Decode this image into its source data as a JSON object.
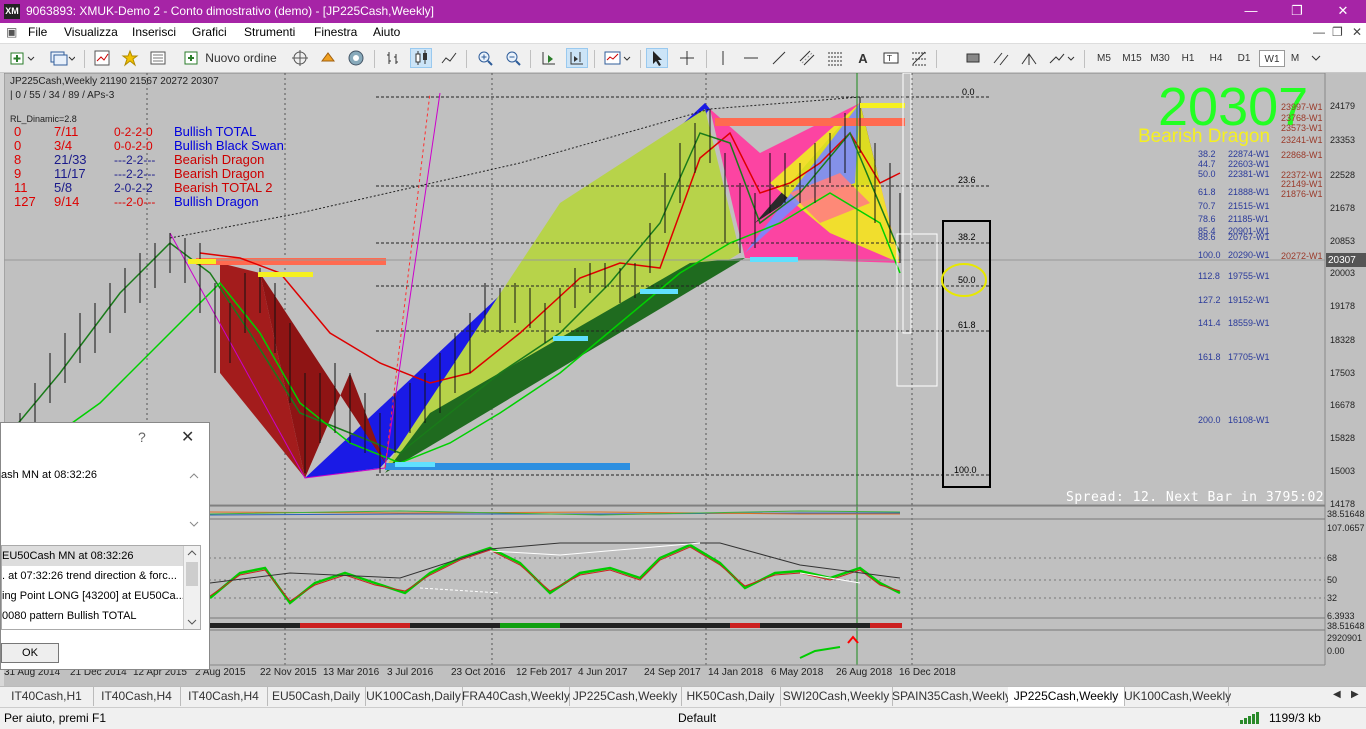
{
  "window": {
    "title": "9063893: XMUK-Demo 2 - Conto dimostrativo (demo) - [JP225Cash,Weekly]",
    "app_logo": "XM"
  },
  "menu": [
    "File",
    "Visualizza",
    "Inserisci",
    "Grafici",
    "Strumenti",
    "Finestra",
    "Aiuto"
  ],
  "toolbar": {
    "new_order": "Nuovo ordine",
    "timeframes": [
      "M5",
      "M15",
      "M30",
      "H1",
      "H4",
      "D1",
      "W1",
      "M"
    ],
    "active_timeframe": "W1"
  },
  "chart": {
    "symbol_line": "JP225Cash,Weekly  21190 21567 20272 20307",
    "indicator_line": "| 0 / 55 / 34 / 89 / APs-3",
    "rl_label": "RL_Dinamic=2.8",
    "big_price": "20307",
    "big_pattern": "Bearish Dragon",
    "spread_text": "Spread: 12. Next Bar in 3795:02",
    "patterns": [
      {
        "n": "0",
        "r": "7/11",
        "c": "0-2-2-0",
        "name": "Bullish TOTAL",
        "color": "#0000dd"
      },
      {
        "n": "0",
        "r": "3/4",
        "c": "0-0-2-0",
        "name": "Bullish Black Swan",
        "color": "#0000dd"
      },
      {
        "n": "8",
        "r": "21/33",
        "c": "---2-2---",
        "name": "Bearish Dragon",
        "color": "#cc0000"
      },
      {
        "n": "9",
        "r": "11/17",
        "c": "---2-2---",
        "name": "Bearish Dragon",
        "color": "#cc0000"
      },
      {
        "n": "11",
        "r": "5/8",
        "c": "2-0-2-2",
        "name": "Bearish TOTAL 2",
        "color": "#cc0000"
      },
      {
        "n": "127",
        "r": "9/14",
        "c": "---2-0---",
        "name": "Bullish Dragon",
        "color": "#0000dd"
      }
    ],
    "price_axis": [
      "24179",
      "23353",
      "22528",
      "21678",
      "20853",
      "20003",
      "19178",
      "18328",
      "17503",
      "16678",
      "15828",
      "15003",
      "14178"
    ],
    "current_price": "20307",
    "fib_box_levels": [
      "0.0",
      "23.6",
      "38.2",
      "50.0",
      "61.8",
      "100.0"
    ],
    "fib_levels_left": [
      {
        "p": "38.2",
        "v": "22874-W1"
      },
      {
        "p": "44.7",
        "v": "22603-W1"
      },
      {
        "p": "50.0",
        "v": "22381-W1"
      },
      {
        "p": "61.8",
        "v": "21888-W1"
      },
      {
        "p": "70.7",
        "v": "21515-W1"
      },
      {
        "p": "78.6",
        "v": "21185-W1"
      },
      {
        "p": "85.4",
        "v": "20901-W1"
      },
      {
        "p": "88.6",
        "v": "20767-W1"
      },
      {
        "p": "100.0",
        "v": "20290-W1"
      },
      {
        "p": "112.8",
        "v": "19755-W1"
      },
      {
        "p": "127.2",
        "v": "19152-W1"
      },
      {
        "p": "141.4",
        "v": "18559-W1"
      },
      {
        "p": "161.8",
        "v": "17705-W1"
      },
      {
        "p": "200.0",
        "v": "16108-W1"
      }
    ],
    "fib_levels_right": [
      "23997-W1",
      "23768-W1",
      "23573-W1",
      "23241-W1",
      "22868-W1",
      "22372-W1",
      "22149-W1",
      "21876-W1",
      "20272-W1"
    ],
    "osc_axis": [
      "107.0657",
      "68",
      "50",
      "32",
      "6.3933"
    ],
    "vol_axis": [
      "2920901",
      "0.00"
    ],
    "small_axis": [
      "38.51648"
    ],
    "date_axis": [
      "31 Aug 2014",
      "21 Dec 2014",
      "12 Apr 2015",
      "2 Aug 2015",
      "22 Nov 2015",
      "13 Mar 2016",
      "3 Jul 2016",
      "23 Oct 2016",
      "12 Feb 2017",
      "4 Jun 2017",
      "24 Sep 2017",
      "14 Jan 2018",
      "6 May 2018",
      "26 Aug 2018",
      "16 Dec 2018"
    ]
  },
  "dialog": {
    "message": "ash MN at 08:32:26",
    "list": [
      "EU50Cash MN at 08:32:26",
      ". at 07:32:26 trend direction & forc...",
      "ing Point LONG [43200] at EU50Ca...",
      "0080 pattern Bullish TOTAL"
    ],
    "ok": "OK"
  },
  "tabs": [
    "IT40Cash,H1",
    "IT40Cash,H4",
    "IT40Cash,H4",
    "EU50Cash,Daily",
    "UK100Cash,Daily",
    "FRA40Cash,Weekly",
    "JP225Cash,Weekly",
    "HK50Cash,Daily",
    "SWI20Cash,Weekly",
    "SPAIN35Cash,Weekly",
    "JP225Cash,Weekly",
    "UK100Cash,Weekly"
  ],
  "active_tab_index": 10,
  "status": {
    "help": "Per aiuto, premi F1",
    "profile": "Default",
    "traffic": "1199/3 kb"
  }
}
